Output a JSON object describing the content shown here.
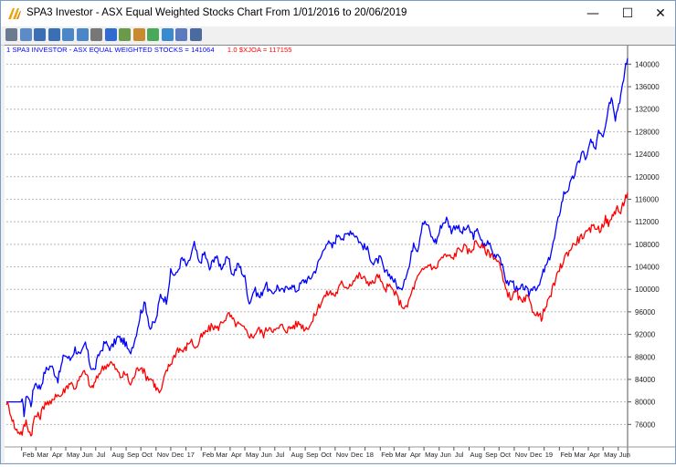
{
  "window": {
    "title": "SPA3 Investor - ASX Equal Weighted Stocks Chart From 1/01/2016 to 20/06/2019",
    "minimize_glyph": "—",
    "maximize_glyph": "☐",
    "close_glyph": "✕"
  },
  "toolbar": {
    "icons": [
      "print-icon",
      "print-preview-icon",
      "zoom-in-icon",
      "zoom-out-icon",
      "zoom-fit-icon",
      "zoom-reset-icon",
      "crosshair-icon",
      "info-icon",
      "copy-icon",
      "settings-icon",
      "chart-options-icon",
      "export-icon",
      "window-icon",
      "exit-icon"
    ]
  },
  "legend": {
    "series1": "1 SPA3 INVESTOR - ASX EQUAL WEIGHTED STOCKS = 141064",
    "series2": "1.0 $XJOA = 117155"
  },
  "colors": {
    "series1": "#0000ff",
    "series2": "#ff0000",
    "grid": "#b8b8b8"
  },
  "chart_data": {
    "type": "line",
    "ylim": [
      72000,
      142000
    ],
    "yticks": [
      "76000",
      "80000",
      "84000",
      "88000",
      "92000",
      "96000",
      "100000",
      "104000",
      "108000",
      "112000",
      "116000",
      "120000",
      "124000",
      "128000",
      "132000",
      "136000",
      "140000"
    ],
    "xticks": [
      "Feb",
      "Mar",
      "Apr",
      "May",
      "Jun",
      "Jul",
      "Aug",
      "Sep",
      "Oct",
      "Nov",
      "Dec",
      "17",
      "Feb",
      "Mar",
      "Apr",
      "May",
      "Jun",
      "Jul",
      "Aug",
      "Sep",
      "Oct",
      "Nov",
      "Dec",
      "18",
      "Feb",
      "Mar",
      "Apr",
      "May",
      "Jun",
      "Jul",
      "Aug",
      "Sep",
      "Oct",
      "Nov",
      "Dec",
      "19",
      "Feb",
      "Mar",
      "Apr",
      "May",
      "Jun"
    ],
    "x_start": "2016-01-01",
    "x_end": "2019-06-20",
    "series": [
      {
        "name": "SPA3 INVESTOR - ASX EQUAL WEIGHTED STOCKS",
        "points": [
          [
            "2016-01-01",
            80000
          ],
          [
            "2016-01-20",
            80000
          ],
          [
            "2016-02-02",
            80000
          ],
          [
            "2016-02-06",
            78000
          ],
          [
            "2016-02-12",
            81500
          ],
          [
            "2016-02-20",
            79500
          ],
          [
            "2016-02-28",
            83500
          ],
          [
            "2016-03-10",
            82500
          ],
          [
            "2016-03-20",
            85500
          ],
          [
            "2016-04-01",
            86500
          ],
          [
            "2016-04-15",
            84000
          ],
          [
            "2016-04-28",
            88500
          ],
          [
            "2016-05-10",
            87500
          ],
          [
            "2016-05-20",
            89500
          ],
          [
            "2016-05-31",
            88000
          ],
          [
            "2016-06-10",
            90500
          ],
          [
            "2016-06-20",
            86500
          ],
          [
            "2016-06-28",
            85500
          ],
          [
            "2016-07-08",
            88500
          ],
          [
            "2016-07-20",
            90500
          ],
          [
            "2016-08-01",
            89500
          ],
          [
            "2016-08-15",
            91500
          ],
          [
            "2016-08-30",
            90500
          ],
          [
            "2016-09-08",
            88500
          ],
          [
            "2016-09-20",
            91500
          ],
          [
            "2016-10-01",
            96000
          ],
          [
            "2016-10-10",
            97500
          ],
          [
            "2016-10-20",
            93000
          ],
          [
            "2016-11-01",
            94500
          ],
          [
            "2016-11-10",
            99000
          ],
          [
            "2016-11-22",
            98000
          ],
          [
            "2016-12-01",
            103000
          ],
          [
            "2016-12-12",
            102500
          ],
          [
            "2016-12-24",
            105500
          ],
          [
            "2017-01-04",
            104000
          ],
          [
            "2017-01-18",
            108000
          ],
          [
            "2017-01-28",
            104500
          ],
          [
            "2017-02-08",
            106500
          ],
          [
            "2017-02-18",
            103500
          ],
          [
            "2017-03-01",
            106000
          ],
          [
            "2017-03-14",
            104000
          ],
          [
            "2017-03-28",
            105500
          ],
          [
            "2017-04-06",
            102500
          ],
          [
            "2017-04-18",
            104500
          ],
          [
            "2017-05-01",
            102000
          ],
          [
            "2017-05-10",
            97500
          ],
          [
            "2017-05-20",
            100000
          ],
          [
            "2017-06-01",
            98500
          ],
          [
            "2017-06-12",
            101000
          ],
          [
            "2017-06-24",
            99000
          ],
          [
            "2017-07-06",
            100500
          ],
          [
            "2017-07-18",
            99500
          ],
          [
            "2017-08-01",
            100800
          ],
          [
            "2017-08-14",
            99800
          ],
          [
            "2017-08-28",
            101500
          ],
          [
            "2017-09-10",
            101800
          ],
          [
            "2017-09-22",
            103500
          ],
          [
            "2017-10-04",
            106000
          ],
          [
            "2017-10-14",
            108500
          ],
          [
            "2017-10-26",
            107500
          ],
          [
            "2017-11-08",
            110000
          ],
          [
            "2017-11-18",
            109000
          ],
          [
            "2017-12-02",
            110500
          ],
          [
            "2017-12-14",
            109500
          ],
          [
            "2017-12-24",
            108000
          ],
          [
            "2018-01-06",
            107000
          ],
          [
            "2018-01-18",
            104500
          ],
          [
            "2018-02-01",
            105500
          ],
          [
            "2018-02-10",
            103000
          ],
          [
            "2018-02-22",
            102500
          ],
          [
            "2018-03-05",
            101000
          ],
          [
            "2018-03-15",
            99500
          ],
          [
            "2018-03-22",
            102000
          ],
          [
            "2018-04-01",
            104000
          ],
          [
            "2018-04-10",
            108500
          ],
          [
            "2018-04-18",
            107000
          ],
          [
            "2018-04-28",
            112000
          ],
          [
            "2018-05-08",
            111500
          ],
          [
            "2018-05-18",
            109000
          ],
          [
            "2018-05-26",
            108500
          ],
          [
            "2018-06-06",
            111500
          ],
          [
            "2018-06-16",
            112500
          ],
          [
            "2018-06-26",
            110500
          ],
          [
            "2018-07-06",
            111500
          ],
          [
            "2018-07-16",
            110000
          ],
          [
            "2018-07-28",
            111000
          ],
          [
            "2018-08-10",
            109500
          ],
          [
            "2018-08-20",
            110500
          ],
          [
            "2018-08-30",
            107500
          ],
          [
            "2018-09-10",
            108500
          ],
          [
            "2018-09-20",
            106000
          ],
          [
            "2018-10-01",
            106500
          ],
          [
            "2018-10-10",
            103000
          ],
          [
            "2018-10-18",
            101000
          ],
          [
            "2018-10-28",
            101500
          ],
          [
            "2018-11-08",
            99500
          ],
          [
            "2018-11-20",
            100500
          ],
          [
            "2018-12-01",
            99200
          ],
          [
            "2018-12-10",
            100800
          ],
          [
            "2018-12-20",
            100000
          ],
          [
            "2018-12-30",
            103000
          ],
          [
            "2019-01-10",
            105000
          ],
          [
            "2019-01-22",
            109000
          ],
          [
            "2019-02-01",
            113500
          ],
          [
            "2019-02-10",
            117000
          ],
          [
            "2019-02-20",
            118000
          ],
          [
            "2019-03-02",
            120000
          ],
          [
            "2019-03-12",
            122500
          ],
          [
            "2019-03-20",
            124500
          ],
          [
            "2019-03-28",
            123000
          ],
          [
            "2019-04-06",
            126500
          ],
          [
            "2019-04-14",
            124500
          ],
          [
            "2019-04-22",
            128500
          ],
          [
            "2019-05-01",
            127500
          ],
          [
            "2019-05-08",
            130500
          ],
          [
            "2019-05-14",
            133500
          ],
          [
            "2019-05-20",
            134000
          ],
          [
            "2019-05-26",
            130500
          ],
          [
            "2019-06-02",
            133000
          ],
          [
            "2019-06-10",
            136000
          ],
          [
            "2019-06-16",
            140000
          ],
          [
            "2019-06-20",
            141064
          ]
        ]
      },
      {
        "name": "$XJOA",
        "points": [
          [
            "2016-01-01",
            80000
          ],
          [
            "2016-01-08",
            78500
          ],
          [
            "2016-01-20",
            75000
          ],
          [
            "2016-02-02",
            74500
          ],
          [
            "2016-02-10",
            76500
          ],
          [
            "2016-02-20",
            74000
          ],
          [
            "2016-02-28",
            77500
          ],
          [
            "2016-03-10",
            77500
          ],
          [
            "2016-03-20",
            80000
          ],
          [
            "2016-04-01",
            79500
          ],
          [
            "2016-04-10",
            81500
          ],
          [
            "2016-04-20",
            81000
          ],
          [
            "2016-05-01",
            82500
          ],
          [
            "2016-05-10",
            83500
          ],
          [
            "2016-05-20",
            82500
          ],
          [
            "2016-06-01",
            84500
          ],
          [
            "2016-06-10",
            85500
          ],
          [
            "2016-06-20",
            82500
          ],
          [
            "2016-06-28",
            83000
          ],
          [
            "2016-07-10",
            85500
          ],
          [
            "2016-07-22",
            86500
          ],
          [
            "2016-08-01",
            87000
          ],
          [
            "2016-08-10",
            86000
          ],
          [
            "2016-08-20",
            84500
          ],
          [
            "2016-09-01",
            85000
          ],
          [
            "2016-09-10",
            83000
          ],
          [
            "2016-09-22",
            85500
          ],
          [
            "2016-10-01",
            86500
          ],
          [
            "2016-10-12",
            84500
          ],
          [
            "2016-10-24",
            84000
          ],
          [
            "2016-11-01",
            82500
          ],
          [
            "2016-11-10",
            81500
          ],
          [
            "2016-11-22",
            85500
          ],
          [
            "2016-12-05",
            87500
          ],
          [
            "2016-12-15",
            89500
          ],
          [
            "2016-12-28",
            89000
          ],
          [
            "2017-01-10",
            91000
          ],
          [
            "2017-01-22",
            89500
          ],
          [
            "2017-02-01",
            91500
          ],
          [
            "2017-02-12",
            92500
          ],
          [
            "2017-02-24",
            93500
          ],
          [
            "2017-03-06",
            93000
          ],
          [
            "2017-03-18",
            94500
          ],
          [
            "2017-03-30",
            95500
          ],
          [
            "2017-04-10",
            94000
          ],
          [
            "2017-04-22",
            93500
          ],
          [
            "2017-05-04",
            92500
          ],
          [
            "2017-05-16",
            91500
          ],
          [
            "2017-05-28",
            93000
          ],
          [
            "2017-06-08",
            92000
          ],
          [
            "2017-06-20",
            93500
          ],
          [
            "2017-07-02",
            92500
          ],
          [
            "2017-07-14",
            93500
          ],
          [
            "2017-07-26",
            92800
          ],
          [
            "2017-08-08",
            93500
          ],
          [
            "2017-08-20",
            94000
          ],
          [
            "2017-09-01",
            93000
          ],
          [
            "2017-09-14",
            94000
          ],
          [
            "2017-09-26",
            96500
          ],
          [
            "2017-10-08",
            98500
          ],
          [
            "2017-10-20",
            99500
          ],
          [
            "2017-11-01",
            99000
          ],
          [
            "2017-11-14",
            101000
          ],
          [
            "2017-11-26",
            100500
          ],
          [
            "2017-12-08",
            101500
          ],
          [
            "2017-12-20",
            102500
          ],
          [
            "2018-01-04",
            101500
          ],
          [
            "2018-01-16",
            101000
          ],
          [
            "2018-01-28",
            102500
          ],
          [
            "2018-02-08",
            100000
          ],
          [
            "2018-02-20",
            100500
          ],
          [
            "2018-03-02",
            99500
          ],
          [
            "2018-03-14",
            97500
          ],
          [
            "2018-03-26",
            96500
          ],
          [
            "2018-04-06",
            99500
          ],
          [
            "2018-04-18",
            102000
          ],
          [
            "2018-04-30",
            103500
          ],
          [
            "2018-05-12",
            104500
          ],
          [
            "2018-05-24",
            103500
          ],
          [
            "2018-06-04",
            105500
          ],
          [
            "2018-06-16",
            106000
          ],
          [
            "2018-06-28",
            105500
          ],
          [
            "2018-07-10",
            107000
          ],
          [
            "2018-07-22",
            107500
          ],
          [
            "2018-08-03",
            106500
          ],
          [
            "2018-08-15",
            108500
          ],
          [
            "2018-08-27",
            107500
          ],
          [
            "2018-09-08",
            106500
          ],
          [
            "2018-09-20",
            106000
          ],
          [
            "2018-10-02",
            104500
          ],
          [
            "2018-10-12",
            100500
          ],
          [
            "2018-10-24",
            98500
          ],
          [
            "2018-11-05",
            99500
          ],
          [
            "2018-11-16",
            97500
          ],
          [
            "2018-11-28",
            98500
          ],
          [
            "2018-12-08",
            96500
          ],
          [
            "2018-12-18",
            95500
          ],
          [
            "2018-12-26",
            95000
          ],
          [
            "2019-01-08",
            97500
          ],
          [
            "2019-01-20",
            100500
          ],
          [
            "2019-02-01",
            103500
          ],
          [
            "2019-02-14",
            106000
          ],
          [
            "2019-02-26",
            107500
          ],
          [
            "2019-03-08",
            108500
          ],
          [
            "2019-03-20",
            109500
          ],
          [
            "2019-04-01",
            110000
          ],
          [
            "2019-04-12",
            111500
          ],
          [
            "2019-04-24",
            110500
          ],
          [
            "2019-05-06",
            112500
          ],
          [
            "2019-05-14",
            111500
          ],
          [
            "2019-05-22",
            113500
          ],
          [
            "2019-05-30",
            114500
          ],
          [
            "2019-06-06",
            113500
          ],
          [
            "2019-06-14",
            116000
          ],
          [
            "2019-06-20",
            117155
          ]
        ]
      }
    ]
  }
}
